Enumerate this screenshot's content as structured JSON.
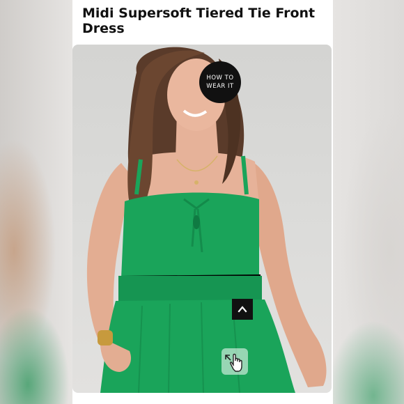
{
  "product": {
    "title": "Midi Supersoft Tiered Tie Front Dress"
  },
  "photo": {
    "dress_color": "#1aa45a"
  },
  "badges": {
    "how_to_line1": "HOW TO",
    "how_to_line2": "WEAR IT"
  },
  "controls": {
    "scroll_top_icon": "chevron-up-icon",
    "zoom_icon": "hand-pointer-expand-icon"
  }
}
